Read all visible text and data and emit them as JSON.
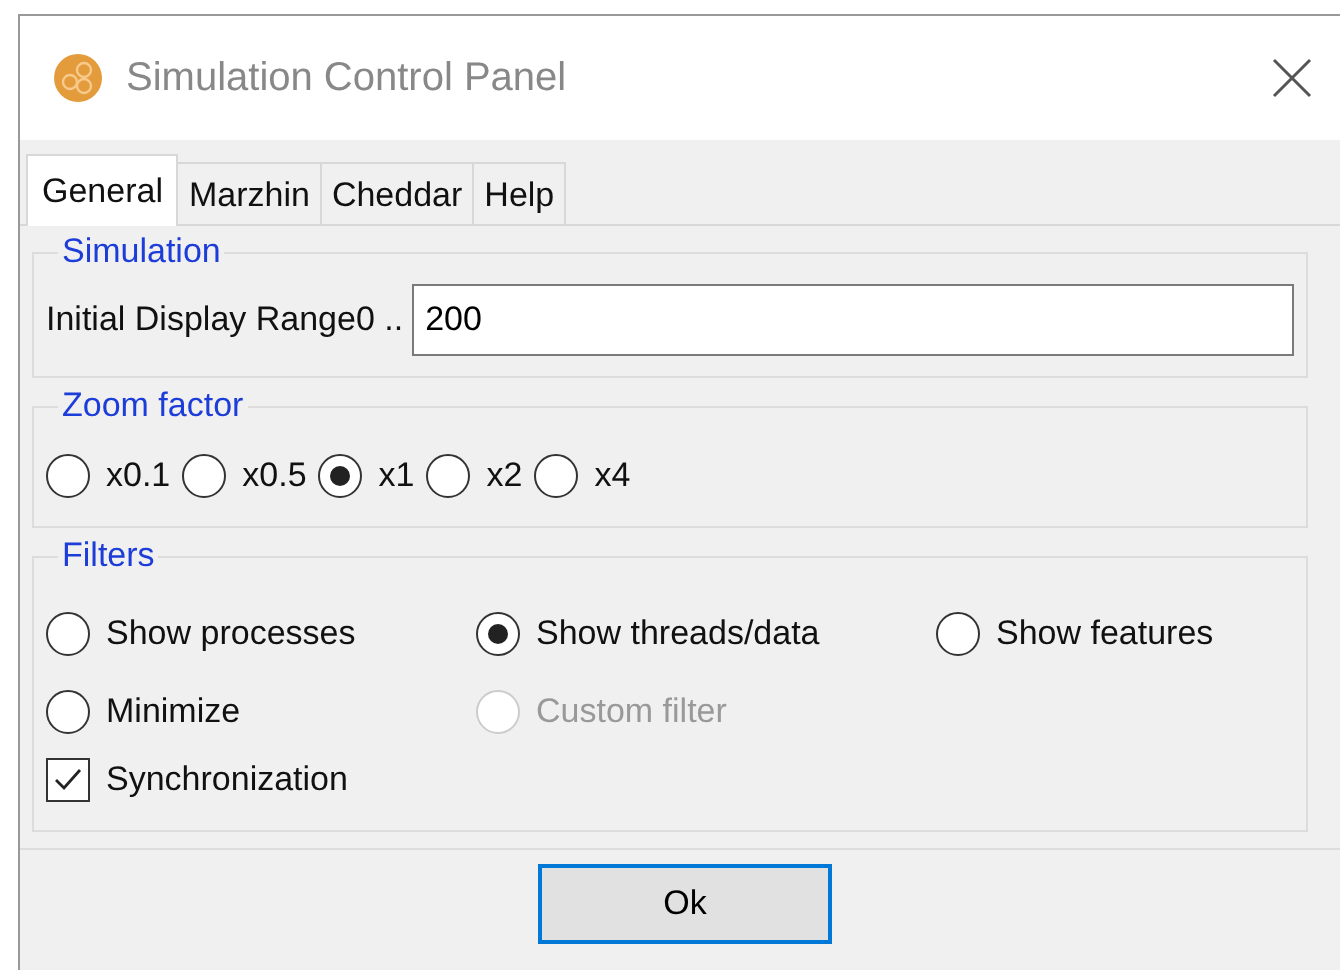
{
  "window": {
    "title": "Simulation Control Panel"
  },
  "tabs": [
    {
      "label": "General",
      "selected": true
    },
    {
      "label": "Marzhin",
      "selected": false
    },
    {
      "label": "Cheddar",
      "selected": false
    },
    {
      "label": "Help",
      "selected": false
    }
  ],
  "simulation": {
    "title": "Simulation",
    "range_label": "Initial Display Range",
    "range_prefix": "0 ..",
    "range_value": "200"
  },
  "zoom_factor": {
    "title": "Zoom factor",
    "options": [
      {
        "label": "x0.1",
        "selected": false
      },
      {
        "label": "x0.5",
        "selected": false
      },
      {
        "label": "x1",
        "selected": true
      },
      {
        "label": "x2",
        "selected": false
      },
      {
        "label": "x4",
        "selected": false
      }
    ]
  },
  "filters": {
    "title": "Filters",
    "options": [
      {
        "label": "Show processes",
        "selected": false,
        "disabled": false
      },
      {
        "label": "Show threads/data",
        "selected": true,
        "disabled": false
      },
      {
        "label": "Show features",
        "selected": false,
        "disabled": false
      },
      {
        "label": "Minimize",
        "selected": false,
        "disabled": false
      },
      {
        "label": "Custom filter",
        "selected": false,
        "disabled": true
      }
    ],
    "synchronization": {
      "label": "Synchronization",
      "checked": true
    }
  },
  "buttons": [
    "Ok"
  ]
}
